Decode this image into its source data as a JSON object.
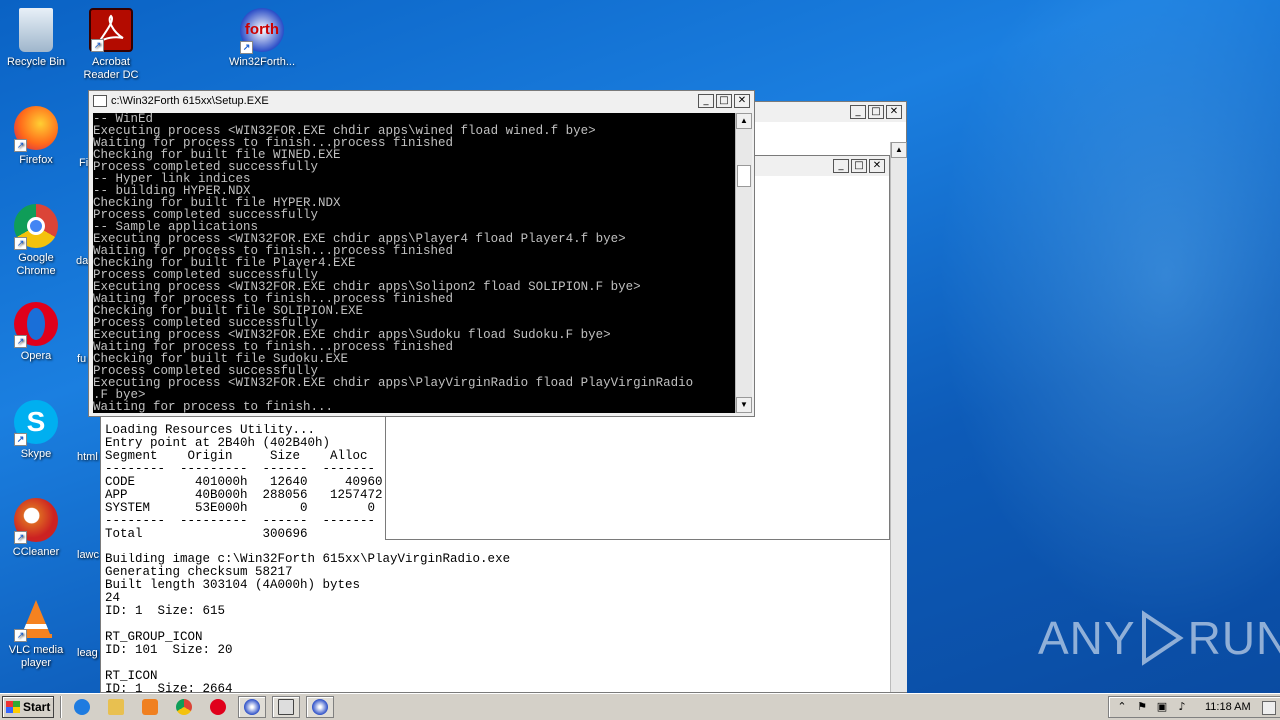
{
  "desktop": {
    "icons": [
      {
        "label": "Recycle Bin",
        "icon": "recycle-bin-icon"
      },
      {
        "label": "Acrobat Reader DC",
        "icon": "acrobat-icon"
      },
      {
        "label": "Win32Forth...",
        "icon": "forth-icon"
      },
      {
        "label": "Firefox",
        "icon": "firefox-icon"
      },
      {
        "label": "Google Chrome",
        "icon": "chrome-icon"
      },
      {
        "label": "Opera",
        "icon": "opera-icon"
      },
      {
        "label": "Skype",
        "icon": "skype-icon"
      },
      {
        "label": "CCleaner",
        "icon": "ccleaner-icon"
      },
      {
        "label": "VLC media player",
        "icon": "vlc-icon"
      }
    ],
    "partial_labels": [
      "Fi",
      "da",
      "fu",
      "html",
      "lawc",
      "leag"
    ]
  },
  "setup_window": {
    "title": "c:\\Win32Forth 615xx\\Setup.EXE",
    "console_lines": [
      "-- WinEd",
      "Executing process <WIN32FOR.EXE chdir apps\\wined fload wined.f bye>",
      "Waiting for process to finish...process finished",
      "Checking for built file WINED.EXE",
      "Process completed successfully",
      "-- Hyper link indices",
      "-- building HYPER.NDX",
      "Checking for built file HYPER.NDX",
      "Process completed successfully",
      "-- Sample applications",
      "Executing process <WIN32FOR.EXE chdir apps\\Player4 fload Player4.f bye>",
      "Waiting for process to finish...process finished",
      "Checking for built file Player4.EXE",
      "Process completed successfully",
      "Executing process <WIN32FOR.EXE chdir apps\\Solipon2 fload SOLIPION.F bye>",
      "Waiting for process to finish...process finished",
      "Checking for built file SOLIPION.EXE",
      "Process completed successfully",
      "Executing process <WIN32FOR.EXE chdir apps\\Sudoku fload Sudoku.F bye>",
      "Waiting for process to finish...process finished",
      "Checking for built file Sudoku.EXE",
      "Process completed successfully",
      "Executing process <WIN32FOR.EXE chdir apps\\PlayVirginRadio fload PlayVirginRadio",
      ".F bye>",
      "Waiting for process to finish..."
    ]
  },
  "output_window": {
    "segment_text_lines": [
      "Loading Resources Utility...",
      "Entry point at 2B40h (402B40h)",
      "Segment    Origin     Size    Alloc",
      "--------  ---------  ------  -------",
      "CODE        401000h   12640     40960",
      "APP         40B000h  288056   1257472",
      "SYSTEM      53E000h       0        0",
      "--------  ---------  ------  -------",
      "Total                300696"
    ],
    "build_text_lines": [
      "Building image c:\\Win32Forth 615xx\\PlayVirginRadio.exe",
      "Generating checksum 58217",
      "Built length 303104 (4A000h) bytes",
      "24",
      "ID: 1  Size: 615",
      "",
      "RT_GROUP_ICON",
      "ID: 101  Size: 20",
      "",
      "RT_ICON",
      "ID: 1  Size: 2664"
    ]
  },
  "taskbar": {
    "start_label": "Start",
    "items": [
      "ie-icon",
      "explorer-icon",
      "media-player-icon",
      "chrome-icon",
      "opera-icon",
      "forth-icon",
      "console-icon",
      "forth-icon"
    ],
    "clock": "11:18 AM"
  },
  "watermark": {
    "left": "ANY",
    "right": "RUN"
  }
}
